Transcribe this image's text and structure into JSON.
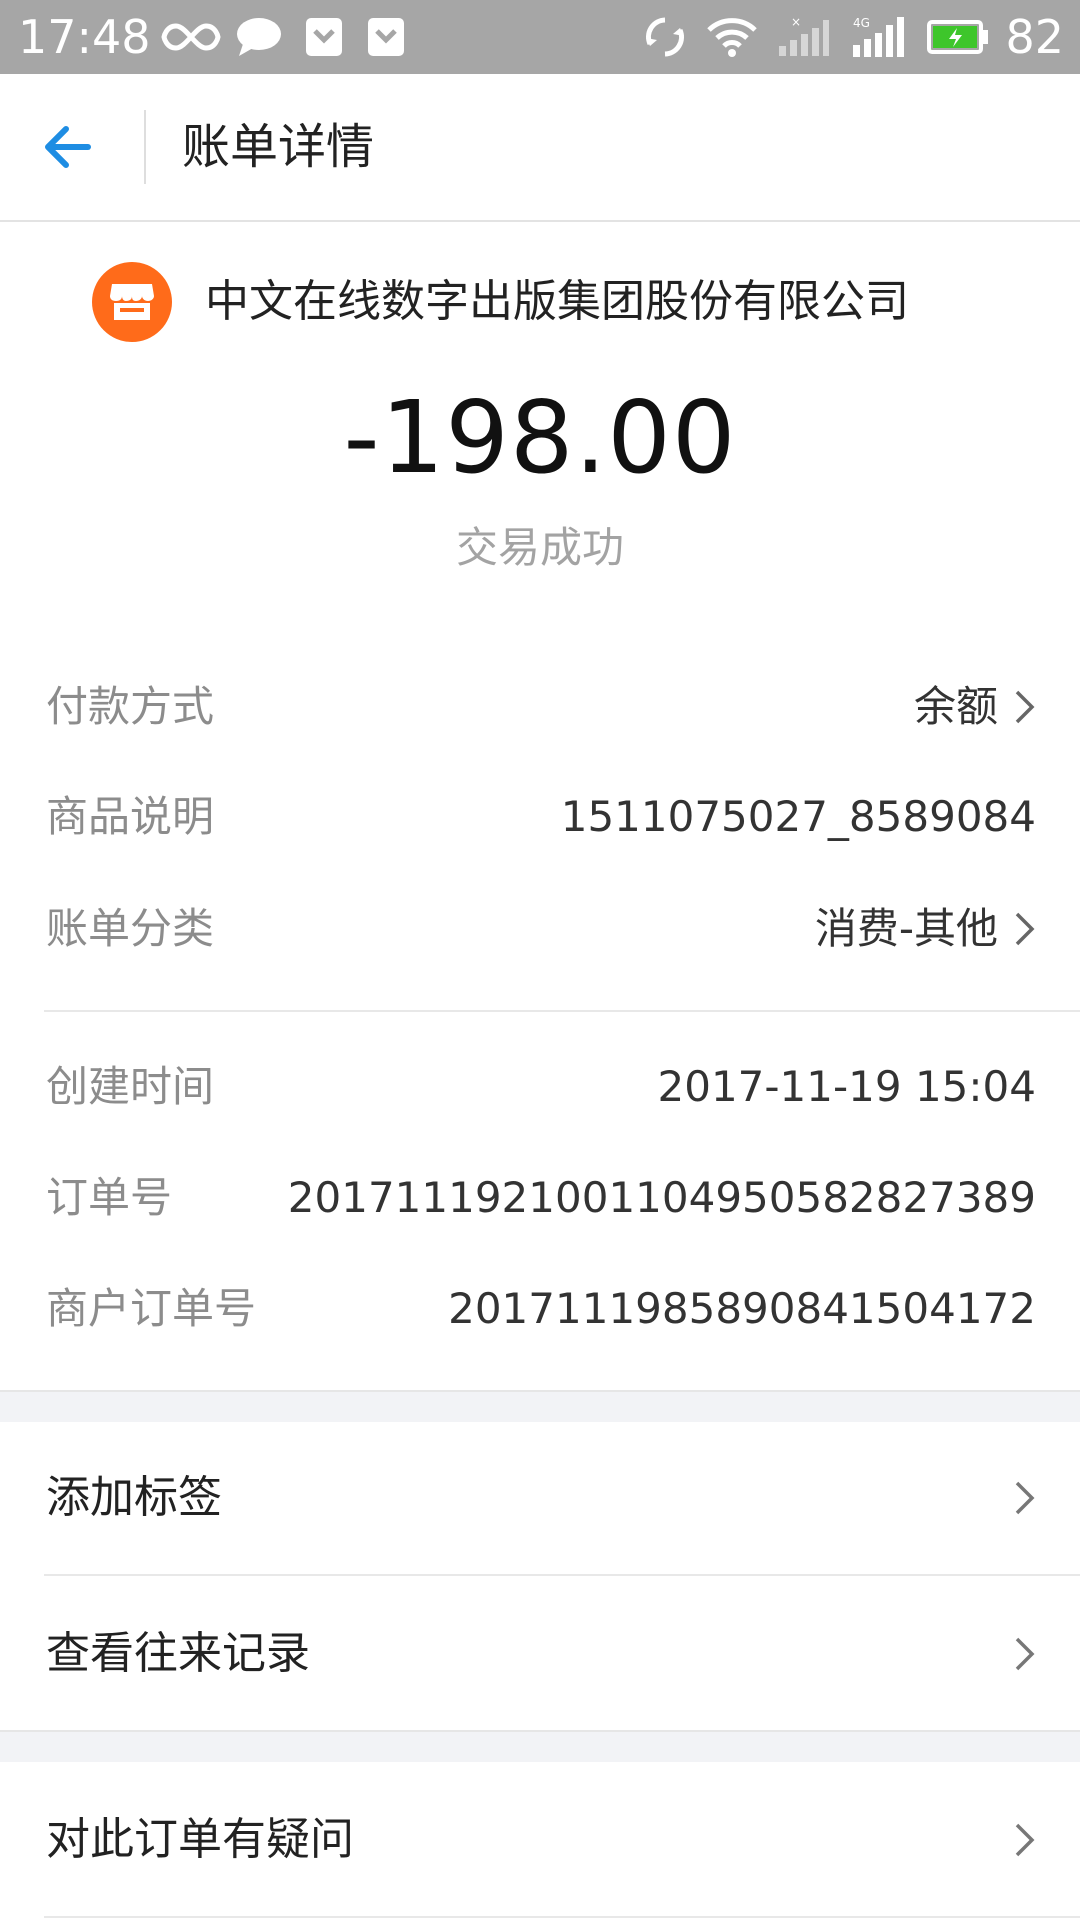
{
  "status_bar": {
    "time": "17:48",
    "battery_percent": "82",
    "icons": [
      "infinity-icon",
      "chat-bubble-icon",
      "shield-icon",
      "shield-icon",
      "rotate-icon",
      "wifi-icon",
      "signal-empty-icon",
      "signal-4g-icon",
      "battery-charging-icon"
    ],
    "network_label": "4G"
  },
  "header": {
    "title": "账单详情"
  },
  "merchant": {
    "name": "中文在线数字出版集团股份有限公司",
    "logo_icon": "store-icon",
    "logo_color": "#ff6b1a"
  },
  "transaction": {
    "amount": "-198.00",
    "status": "交易成功"
  },
  "details": [
    {
      "label": "付款方式",
      "value": "余额",
      "has_chevron": true
    },
    {
      "label": "商品说明",
      "value": "1511075027_8589084",
      "has_chevron": false
    },
    {
      "label": "账单分类",
      "value": "消费-其他",
      "has_chevron": true
    }
  ],
  "details2": [
    {
      "label": "创建时间",
      "value": "2017-11-19 15:04"
    },
    {
      "label": "订单号",
      "value": "20171119210011049505828273​89"
    },
    {
      "label": "商户订单号",
      "value": "20171119858908415041​72"
    }
  ],
  "actions": {
    "add_tag": "添加标签",
    "view_records": "查看往来记录",
    "question": "对此订单有疑问"
  },
  "colors": {
    "accent": "#1e8de3",
    "status_bar": "#a6a6a6",
    "secondary_text": "#8c8c8c"
  }
}
